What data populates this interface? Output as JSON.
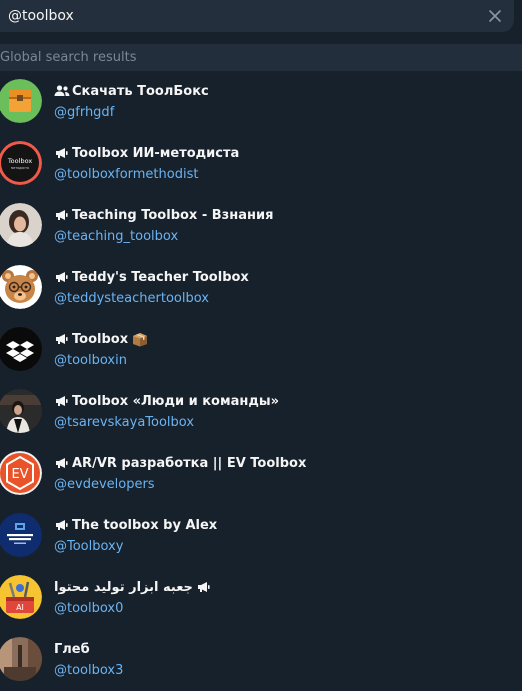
{
  "search": {
    "value": "@toolbox",
    "placeholder": "Search"
  },
  "section": {
    "header": "Global search results"
  },
  "results": [
    {
      "title": "Скачать ТоолБокс",
      "username": "@gfrhgdf",
      "kind": "group",
      "avatar": "chest-orange-avatar"
    },
    {
      "title": "Toolbox ИИ-методиста",
      "username": "@toolboxformethodist",
      "kind": "channel",
      "avatar": "toolbox-methodist-avatar"
    },
    {
      "title": "Teaching Toolbox - Взнания",
      "username": "@teaching_toolbox",
      "kind": "channel",
      "avatar": "woman-photo-avatar"
    },
    {
      "title": "Teddy's Teacher Toolbox",
      "username": "@teddysteachertoolbox",
      "kind": "channel",
      "avatar": "teddy-bear-avatar"
    },
    {
      "title": "Toolbox",
      "username": "@toolboxin",
      "kind": "channel",
      "avatar": "dropbox-style-avatar",
      "emoji": "package-icon"
    },
    {
      "title": "Toolbox «Люди и команды»",
      "username": "@tsarevskayaToolbox",
      "kind": "channel",
      "avatar": "person-photo-avatar"
    },
    {
      "title": "AR/VR разработка || EV Toolbox",
      "username": "@evdevelopers",
      "kind": "channel",
      "avatar": "ev-logo-avatar"
    },
    {
      "title": "The toolbox by Alex",
      "username": "@Toolboxy",
      "kind": "channel",
      "avatar": "toolbox-by-alex-avatar"
    },
    {
      "title": "جعبه ابزار تولید محتوا",
      "username": "@toolbox0",
      "kind": "channel",
      "avatar": "ai-tools-avatar"
    },
    {
      "title": "Глеб",
      "username": "@toolbox3",
      "kind": "user",
      "avatar": "street-photo-avatar"
    }
  ],
  "colors": {
    "background": "#17212b",
    "search_bg": "#242f3d",
    "header_bg": "#232e3c",
    "header_text": "#7a8794",
    "link": "#6ab3f3",
    "title": "#f5f5f5"
  }
}
